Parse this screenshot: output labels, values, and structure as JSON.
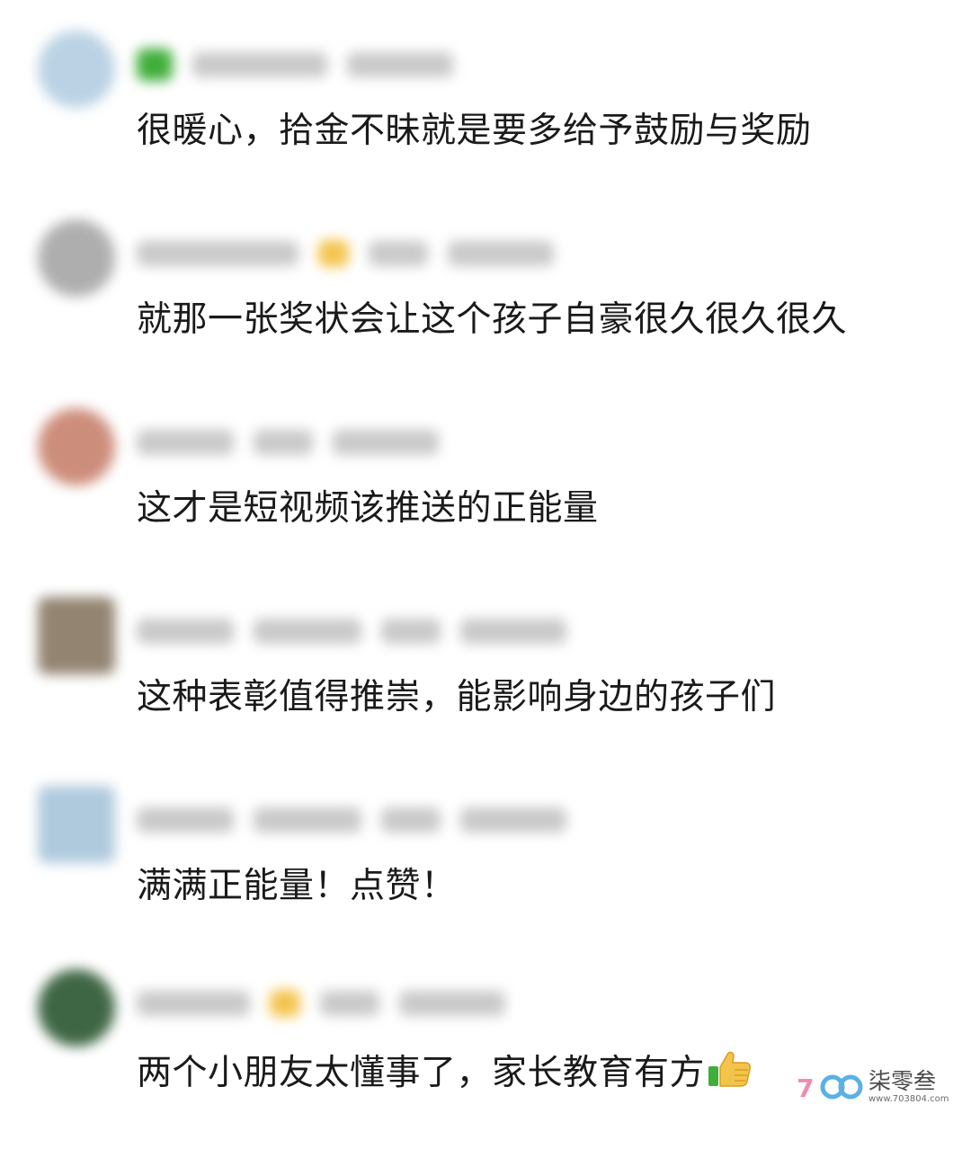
{
  "comments": [
    {
      "avatar_color": "#b5cfe2",
      "badge": "green",
      "text": "很暖心，拾金不昧就是要多给予鼓励与奖励",
      "emoji": ""
    },
    {
      "avatar_color": "#a8a8a8",
      "badge": "gold",
      "text": "就那一张奖状会让这个孩子自豪很久很久很久",
      "emoji": ""
    },
    {
      "avatar_color": "#c98470",
      "badge": "",
      "text": "这才是短视频该推送的正能量",
      "emoji": ""
    },
    {
      "avatar_color": "#8a7a66",
      "badge": "",
      "text": "这种表彰值得推崇，能影响身边的孩子们",
      "emoji": ""
    },
    {
      "avatar_color": "#a9c6da",
      "badge": "",
      "text": "满满正能量！点赞！",
      "emoji": ""
    },
    {
      "avatar_color": "#2f5a35",
      "badge": "gold",
      "text": "两个小朋友太懂事了，家长教育有方",
      "emoji": "thumbs-up-icon"
    }
  ],
  "watermark": {
    "logo": "703",
    "brand": "柒零叁",
    "url": "www.703804.com"
  },
  "colors": {
    "text": "#1a1a1a",
    "blur_gray": "#c9c9c9",
    "badge_green": "#3fae3a",
    "badge_gold": "#f3c44c",
    "logo_pink": "#f08bb0",
    "logo_blue": "#5bb0e6"
  }
}
